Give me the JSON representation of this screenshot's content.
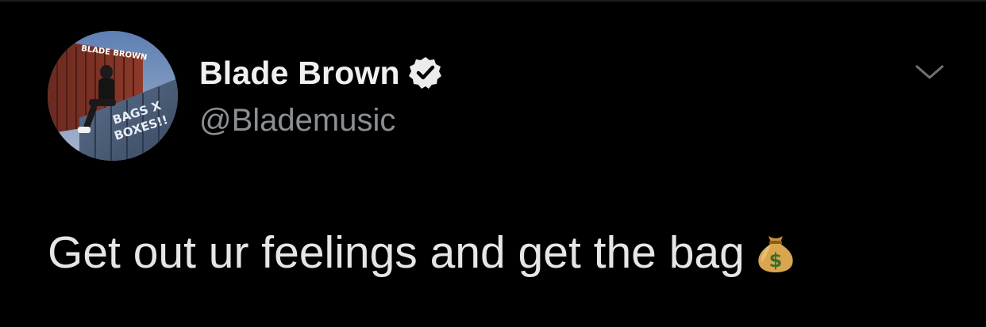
{
  "tweet": {
    "author": {
      "display_name": "Blade Brown",
      "handle": "@Blademusic",
      "verified": true,
      "avatar_text": {
        "top": "BLADE BROWN",
        "line1": "BAGS X",
        "line2": "BOXES!!"
      }
    },
    "text": "Get out ur feelings and get the bag",
    "emoji": "money-bag",
    "menu_icon": "chevron-down-icon"
  },
  "colors": {
    "background": "#000000",
    "name": "#f0f0f0",
    "handle": "#8b8f94",
    "text": "#e6e6e6",
    "chevron": "#6e7378"
  }
}
